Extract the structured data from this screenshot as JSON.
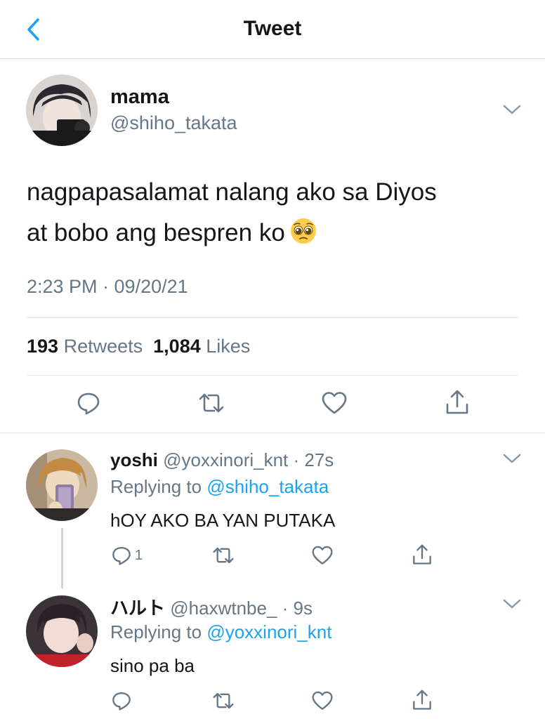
{
  "header": {
    "title": "Tweet"
  },
  "tweet": {
    "author_name": "mama",
    "author_handle": "@shiho_takata",
    "text_line1": "nagpapasalamat nalang ako sa Diyos",
    "text_line2": "at bobo ang bespren ko",
    "emoji": "pleading-face",
    "timestamp": "2:23 PM · 09/20/21",
    "retweets_count": "193",
    "retweets_label": "Retweets",
    "likes_count": "1,084",
    "likes_label": "Likes"
  },
  "replies": [
    {
      "name": "yoshi",
      "meta": "@yoxxinori_knt · 27s",
      "replying_prefix": "Replying to",
      "replying_to": "@shiho_takata",
      "text": "hOY AKO BA YAN PUTAKA",
      "reply_count": "1"
    },
    {
      "name": "ハルト",
      "meta": "@haxwtnbe_ · 9s",
      "replying_prefix": "Replying to",
      "replying_to": "@yoxxinori_knt",
      "text": "sino pa ba",
      "reply_count": ""
    }
  ],
  "colors": {
    "accent": "#1da1f2",
    "text": "#14171a",
    "muted": "#657786",
    "divider": "#dfe3e6"
  },
  "icons": [
    "chevron-left-icon",
    "chevron-down-icon",
    "reply-icon",
    "retweet-icon",
    "heart-icon",
    "share-icon"
  ]
}
